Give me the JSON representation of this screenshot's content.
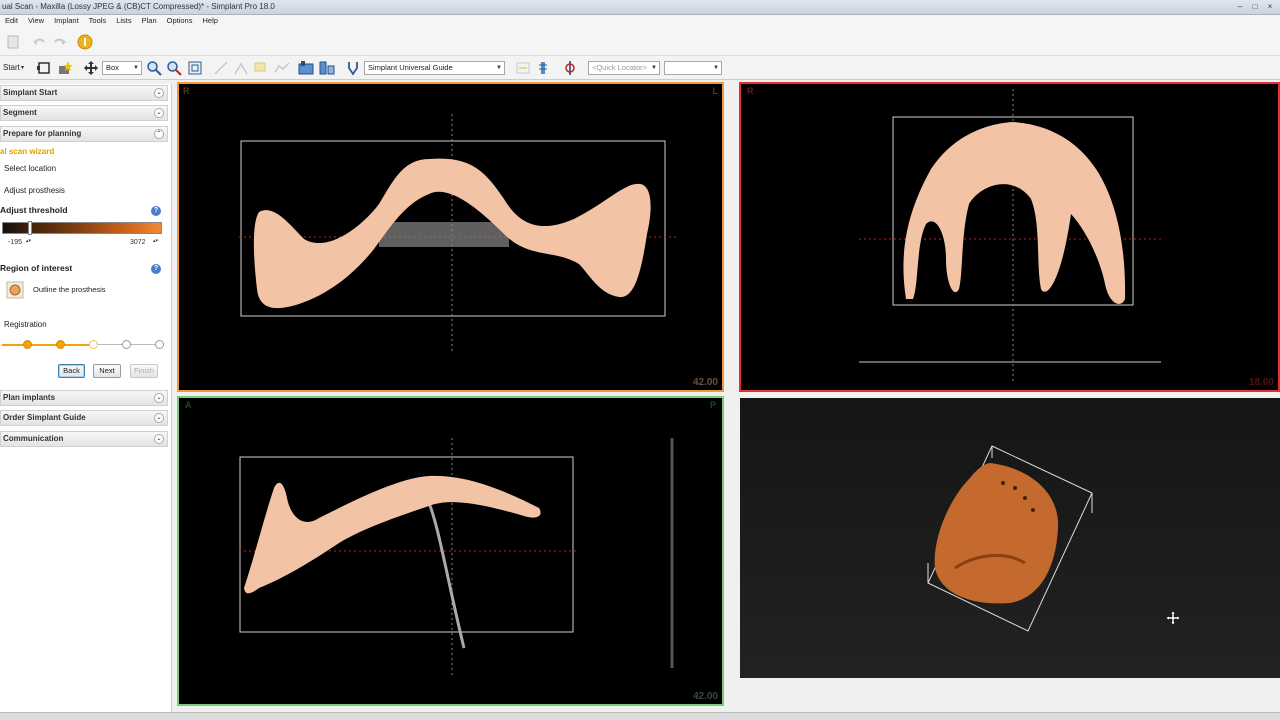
{
  "window": {
    "title": "ual Scan - Maxilla (Lossy JPEG & (CB)CT Compressed)* - Simplant Pro 18.0",
    "buttons": [
      "–",
      "□",
      "×"
    ]
  },
  "menu": [
    "Edit",
    "View",
    "Implant",
    "Tools",
    "Lists",
    "Plan",
    "Options",
    "Help"
  ],
  "toolbar": {
    "start_label": "Start",
    "box_select": "Box",
    "guide_select": "Simplant Universal Guide",
    "quick_locator": "<Quick Locator>",
    "empty_select": ""
  },
  "sidebar": {
    "sections": {
      "simplant_start": "Simplant Start",
      "segment": "Segment",
      "prepare": "Prepare for planning",
      "plan_implants": "Plan implants",
      "order_guide": "Order Simplant Guide",
      "communication": "Communication"
    },
    "wizard_title": "al scan wizard",
    "step_select_location": "Select location",
    "step_adjust_prosthesis": "Adjust prosthesis",
    "adjust_threshold": "Adjust threshold",
    "threshold_min": "-195",
    "threshold_max": "3072",
    "region_of_interest": "Region of interest",
    "outline_prosthesis": "Outline the prosthesis",
    "registration": "Registration",
    "back": "Back",
    "next": "Next",
    "finish": "Finish"
  },
  "views": {
    "axial": {
      "corner_left": "R",
      "corner_right": "L",
      "zoom": "42.00"
    },
    "coronal": {
      "corner_left": "R",
      "zoom": "18.00"
    },
    "sagittal": {
      "corner_left": "A",
      "corner_right": "P",
      "zoom": "42.00"
    }
  },
  "colors": {
    "accent": "#f0a30a",
    "prosthesis": "#f2c3a4",
    "view_axial_border": "#f29a3a",
    "view_coronal_border": "#e03030",
    "view_sagittal_border": "#7acb7a"
  }
}
